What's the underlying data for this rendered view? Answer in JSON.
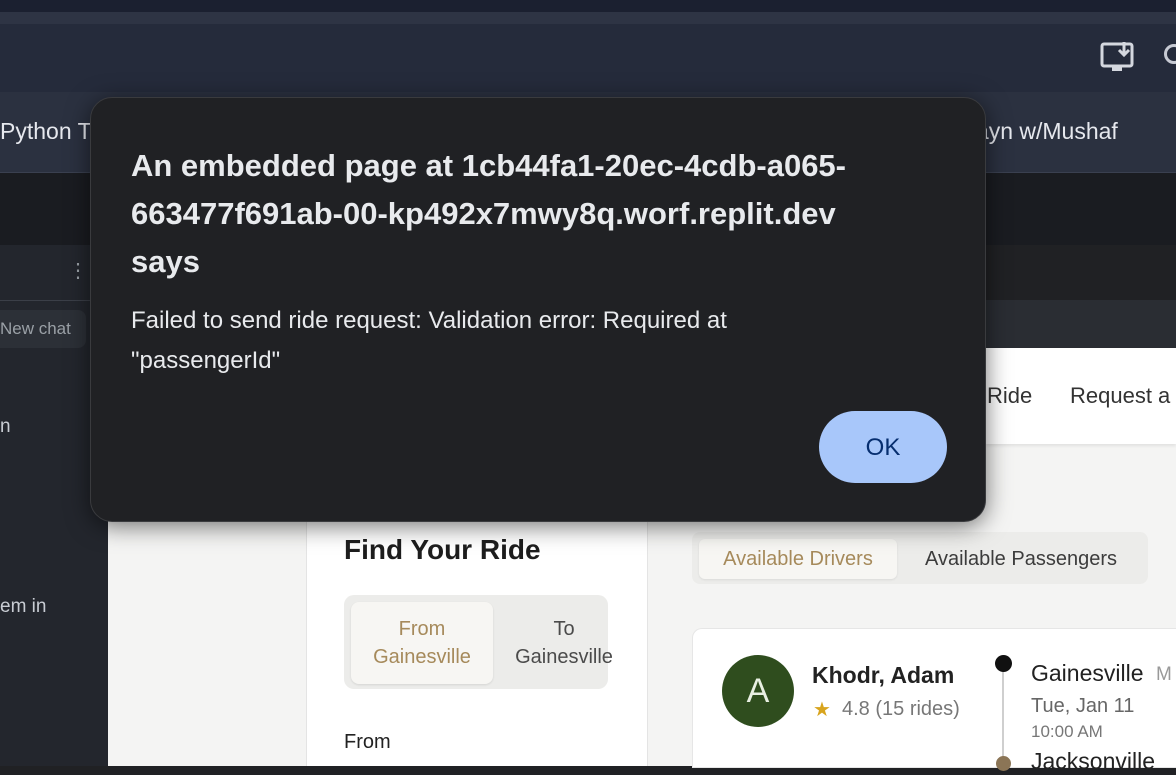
{
  "browser": {
    "bookmarks": {
      "left_label": "Python T",
      "right_label": "alayn w/Mushaf"
    }
  },
  "sidebar": {
    "new_chat_label": "New chat",
    "fragment_1": "n",
    "fragment_2": "em in"
  },
  "app": {
    "nav": {
      "ride_label": "Ride",
      "request_label": "Request a"
    },
    "find_ride": {
      "title": "Find Your Ride",
      "toggle_from": "From Gainesville",
      "toggle_to": "To Gainesville",
      "from_label": "From"
    },
    "tabs": {
      "drivers": "Available Drivers",
      "passengers": "Available Passengers"
    },
    "driver": {
      "avatar_letter": "A",
      "name": "Khodr, Adam",
      "star": "★",
      "rating": "4.8 (15 rides)",
      "origin": "Gainesville",
      "origin_tag": "M",
      "date": "Tue, Jan 11",
      "time": "10:00 AM",
      "destination": "Jacksonville"
    }
  },
  "dialog": {
    "title": "An embedded page at 1cb44fa1-20ec-4cdb-a065-663477f691ab-00-kp492x7mwy8q.worf.replit.dev says",
    "message": "Failed to send ride request: Validation error: Required at \"passengerId\"",
    "ok_label": "OK"
  },
  "colors": {
    "dialog_bg": "#202124",
    "ok_button": "#a8c7fa",
    "accent_gold": "#a68a5b",
    "avatar_green": "#2f4d1e"
  }
}
